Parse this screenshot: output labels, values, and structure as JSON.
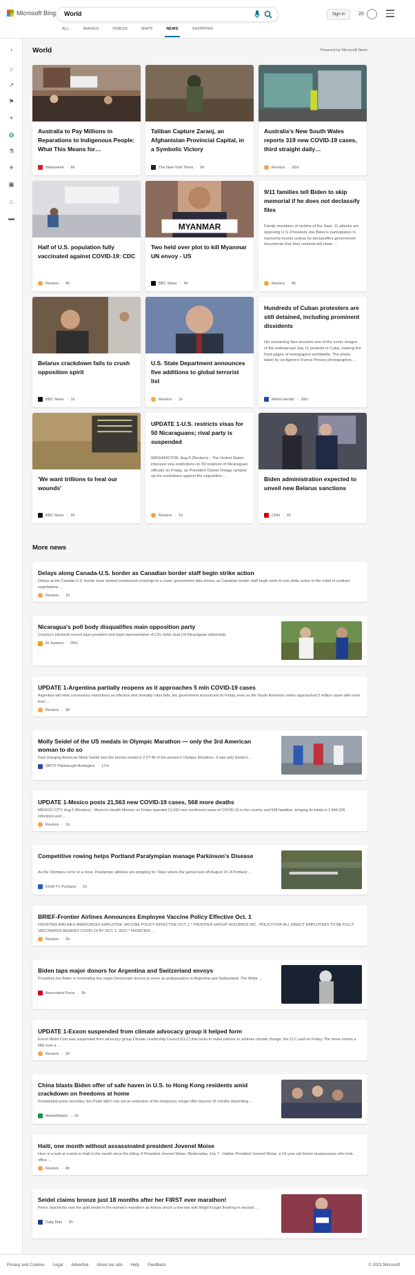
{
  "header": {
    "logo_text": "Microsoft Bing",
    "search_value": "World",
    "signin_label": "Sign in",
    "points": "20",
    "tabs": [
      {
        "label": "ALL",
        "active": false
      },
      {
        "label": "IMAGES",
        "active": false
      },
      {
        "label": "VIDEOS",
        "active": false
      },
      {
        "label": "MAPS",
        "active": false
      },
      {
        "label": "NEWS",
        "active": true
      },
      {
        "label": "SHOPPING",
        "active": false
      }
    ]
  },
  "rail_icons": [
    "expand-icon",
    "home-icon",
    "trending-icon",
    "flag-icon",
    "location-pin-icon",
    "globe-icon",
    "science-icon",
    "rocket-icon",
    "entertainment-icon",
    "politics-icon",
    "money-icon"
  ],
  "world": {
    "title": "World",
    "powered": "Powered by Microsoft News",
    "cards": [
      {
        "title": "Australia to Pay Millions in Reparations to Indigenous People: What This Means for…",
        "snippet": "",
        "source": "Newsweek",
        "time": "6h",
        "src_color": "#d81d25",
        "img": "protest"
      },
      {
        "title": "Taliban Capture Zaranj, an Afghanistan Provincial Capital, in a Symbolic Victory",
        "snippet": "",
        "source": "The New York Times",
        "time": "9h",
        "src_color": "#222222",
        "img": "soldier"
      },
      {
        "title": "Australia's New South Wales reports 319 new COVID-19 cases, third straight daily…",
        "snippet": "",
        "source": "Reuters",
        "time": "20m",
        "src_color": "#f7a24a",
        "img": "street"
      },
      {
        "title": "Half of U.S. population fully vaccinated against COVID-19: CDC",
        "snippet": "",
        "source": "Reuters",
        "time": "4h",
        "src_color": "#f7a24a",
        "img": "clinic"
      },
      {
        "title": "Two held over plot to kill Myanmar UN envoy - US",
        "snippet": "",
        "source": "BBC News",
        "time": "4h",
        "src_color": "#111111",
        "img": "myanmar"
      },
      {
        "title": "9/11 families tell Biden to skip memorial if he does not declassify files",
        "snippet": "Family members of victims of the Sept. 11 attacks are opposing U.S. President Joe Biden's participation in memorial events unless he declassifies government documents that they contend will show …",
        "source": "Reuters",
        "time": "8h",
        "src_color": "#f7a24a",
        "img": ""
      },
      {
        "title": "Belarus crackdown fails to crush opposition spirit",
        "snippet": "",
        "source": "BBC News",
        "time": "1h",
        "src_color": "#111111",
        "img": "selfie"
      },
      {
        "title": "U.S. State Department announces five additions to global terrorist list",
        "snippet": "",
        "source": "Reuters",
        "time": "1h",
        "src_color": "#f7a24a",
        "img": "blinken"
      },
      {
        "title": "Hundreds of Cuban protesters are still detained, including prominent dissidents",
        "snippet": "His screaming face became one of the iconic images of the widespread July 11 protests in Cuba, making the front pages of newspapers worldwide. The photo, taken by an Agence France-Presse photographer, …",
        "source": "Miami Herald",
        "time": "18m",
        "src_color": "#1e4f9e",
        "img": ""
      },
      {
        "title": "'We want trillions to heal our wounds'",
        "snippet": "",
        "source": "BBC News",
        "time": "2h",
        "src_color": "#111111",
        "img": "monument"
      },
      {
        "title": "UPDATE 1-U.S. restricts visas for 50 Nicaraguans; rival party is suspended",
        "snippet": "WASHINGTON, Aug 6 (Reuters) - The United States imposed visa restrictions on 50 relatives of Nicaraguan officials on Friday, as President Daniel Ortega ramped up his crackdown against the opposition …",
        "source": "Reuters",
        "time": "1h",
        "src_color": "#f7a24a",
        "img": ""
      },
      {
        "title": "Biden administration expected to unveil new Belarus sanctions",
        "snippet": "",
        "source": "CNN",
        "time": "2h",
        "src_color": "#cc0000",
        "img": "meeting"
      }
    ]
  },
  "more": {
    "title": "More news",
    "items": [
      {
        "title": "Delays along Canada-U.S. border as Canadian border staff begin strike action",
        "snippet": "Delays at the Canada-U.S. border have slowed commercial crossings to a crawl, government data shows, as Canadian border staff begin work-to-rule strike action in the midst of contract negotiations …",
        "source": "Reuters",
        "time": "1h",
        "src_color": "#f7a24a",
        "thumb": ""
      },
      {
        "title": "Nicaragua's poll body disqualifies main opposition party",
        "snippet": "Country's electoral council says president and legal representative of CXL holds dual US-Nicaraguan citizenship.",
        "source": "Al Jazeera",
        "time": "26m",
        "src_color": "#e8a01d",
        "thumb": "wave"
      },
      {
        "title": "UPDATE 1-Argentina partially reopens as it approaches 5 mln COVID-19 cases",
        "snippet": "Argentina will relax coronavirus restrictions as infection and mortality rates falls, the government announced on Friday, even as the South American nation approached 5 million cases with more than …",
        "source": "Reuters",
        "time": "3h",
        "src_color": "#f7a24a",
        "thumb": ""
      },
      {
        "title": "Molly Seidel of the US medals in Olympic Marathon — only the 3rd American woman to do so",
        "snippet": "Fast-charging American Molly Seidel won the bronze medal in 2:27:46 of the women's Olympic Marathon. It was only Seidel's …",
        "source": "WPTZ Plattsburgh-Burlington",
        "time": "17m",
        "src_color": "#2b4aa3",
        "thumb": "runners"
      },
      {
        "title": "UPDATE 1-Mexico posts 21,563 new COVID-19 cases, 568 more deaths",
        "snippet": "MEXICO CITY, Aug 6 (Reuters) - Mexico's Health Ministry on Friday reported 21,563 new confirmed cases of COVID-19 in the country and 568 fatalities, bringing its totals to 2,944,226 infections and …",
        "source": "Reuters",
        "time": "1h",
        "src_color": "#f7a24a",
        "thumb": ""
      },
      {
        "title": "Competitive rowing helps Portland Paralympian manage Parkinson's Disease",
        "snippet": "As the Olympics come to a close, Paralympic athletes are prepping for Tokyo where the games kick off August 24. A Portland …",
        "source": "KGW-TV Portland",
        "time": "1h",
        "src_color": "#1f5fb0",
        "thumb": "rowing"
      },
      {
        "title": "BRIEF-Frontier Airlines Announces Employee Vaccine Policy Effective Oct. 1",
        "snippet": "FRONTIER AIRLINES ANNOUNCES EMPLOYEE VACCINE POLICY EFFECTIVE OCT. 1 * FRONTIER GROUP HOLDINGS INC - POLICY FOR ALL DIRECT EMPLOYEES TO BE FULLY VACCINATED AGAINST COVID-19 BY OCT. 1, 2021 * FRONTIER …",
        "source": "Reuters",
        "time": "3h",
        "src_color": "#f7a24a",
        "thumb": ""
      },
      {
        "title": "Biden taps major donors for Argentina and Switzerland envoys",
        "snippet": "President Joe Biden is nominating two major Democratic donors to serve as ambassadors to Argentina and Switzerland. The White …",
        "source": "Associated Press",
        "time": "5h",
        "src_color": "#d0021b",
        "thumb": "biden"
      },
      {
        "title": "UPDATE 1-Exxon suspended from climate advocacy group it helped form",
        "snippet": "Exxon Mobil Corp was suspended from advocacy group Climate Leadership Council (CLC) that looks to make policies to address climate change, the CLC said on Friday. The move comes a little over a …",
        "source": "Reuters",
        "time": "2h",
        "src_color": "#f7a24a",
        "thumb": ""
      },
      {
        "title": "China blasts Biden offer of safe haven in U.S. to Hong Kong residents amid crackdown on freedoms at home",
        "snippet": "Presidential press secretary Jen Psaki didn't rule out an extension of the temporary refuge offer beyond 18 months depending …",
        "source": "MarketWatch",
        "time": "2h",
        "src_color": "#1f8f4e",
        "thumb": "crowd"
      },
      {
        "title": "Haiti, one month without assassinated president Jovenel Moise",
        "snippet": "Here is a look at events in Haiti in the month since the killing of President Jovenel Moise. Wednesday, July 7 - Haitian President Jovenel Moise, a 53-year-old former businessman who took office …",
        "source": "Reuters",
        "time": "4h",
        "src_color": "#f7a24a",
        "thumb": ""
      },
      {
        "title": "Seidel claims bronze just 18 months after her FIRST ever marathon!",
        "snippet": "Peres Jepchirchir won the gold medal in the women's marathon as Kenya struck a one-two with Brigid Kosgei finishing in second …",
        "source": "Daily Mail",
        "time": "2h",
        "src_color": "#1d3f8a",
        "thumb": "seidel"
      }
    ]
  },
  "footer": {
    "links": [
      "Privacy and Cookies",
      "Legal",
      "Advertise",
      "About our ads",
      "Help",
      "Feedback"
    ],
    "copyright": "© 2021 Microsoft"
  }
}
